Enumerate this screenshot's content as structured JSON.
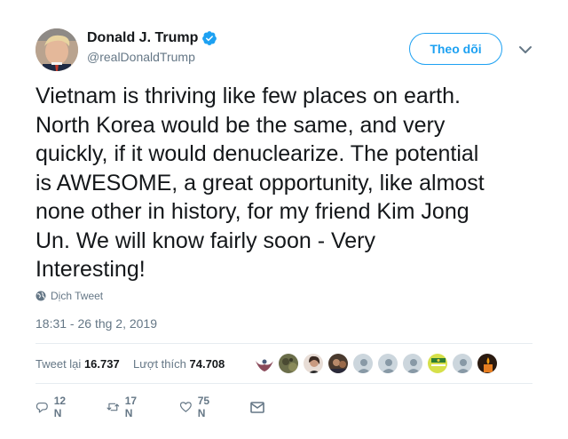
{
  "author": {
    "display_name": "Donald J. Trump",
    "handle": "@realDonaldTrump",
    "verified": true,
    "avatar_icon": "profile-photo",
    "verified_color": "#1da1f2"
  },
  "follow_label": "Theo dõi",
  "tweet_text": "Vietnam is thriving like few places on earth.\nNorth Korea would be the same, and very\nquickly, if it would denuclearize. The potential\nis AWESOME, a great opportunity, like almost\nnone other in history, for my friend Kim Jong\nUn. We will know fairly soon - Very\nInteresting!",
  "translate_label": "Dịch Tweet",
  "timestamp": "18:31 - 26 thg 2, 2019",
  "stats": {
    "retweets_label": "Tweet lại",
    "retweets_count": "16.737",
    "likes_label": "Lượt thích",
    "likes_count": "74.708"
  },
  "likers": [
    {
      "icon": "eagle-avatar-icon",
      "color": "#8a4a5a"
    },
    {
      "icon": "camo-avatar-icon",
      "color": "#6b6e4a"
    },
    {
      "icon": "person-avatar-icon",
      "color": "#5a3a3a"
    },
    {
      "icon": "photo-avatar-icon",
      "color": "#4a3a2e"
    },
    {
      "icon": "default-avatar-icon",
      "color": "#aab8c2"
    },
    {
      "icon": "default-avatar-icon",
      "color": "#aab8c2"
    },
    {
      "icon": "default-avatar-icon",
      "color": "#aab8c2"
    },
    {
      "icon": "flag-avatar-icon",
      "color": "#d6e04a"
    },
    {
      "icon": "default-avatar-icon",
      "color": "#aab8c2"
    },
    {
      "icon": "candle-avatar-icon",
      "color": "#2a1a10"
    }
  ],
  "actions": {
    "reply_count": "12 N",
    "retweet_count": "17 N",
    "like_count": "75 N"
  }
}
